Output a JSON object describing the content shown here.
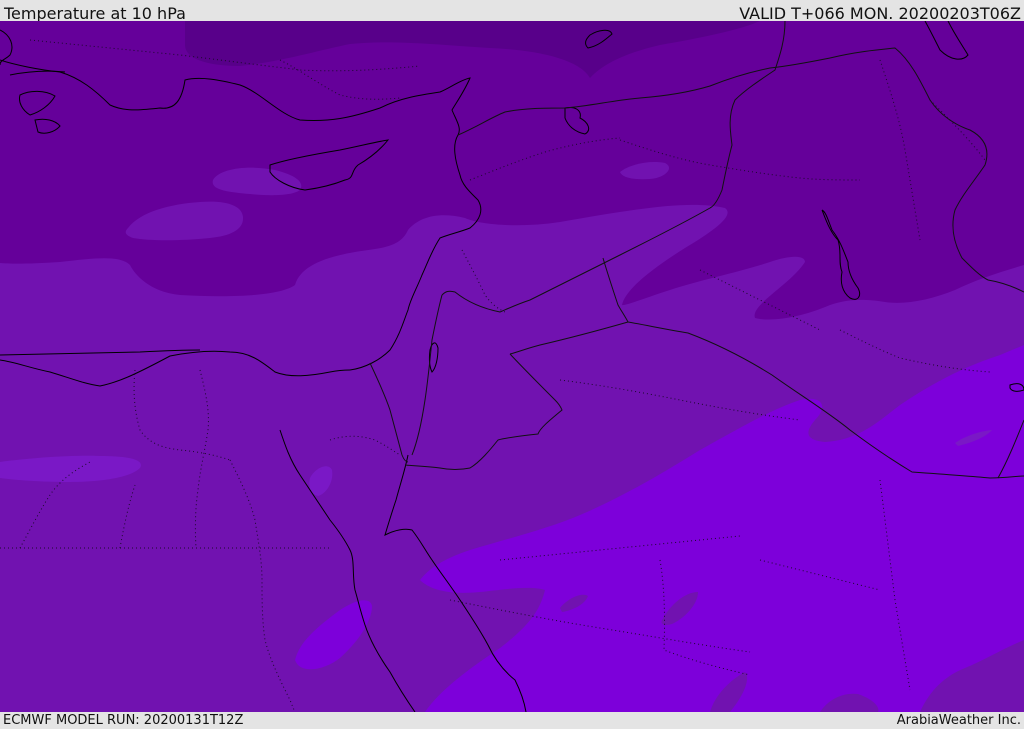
{
  "header": {
    "title": "Temperature at 10 hPa",
    "valid_time": "VALID T+066 MON. 20200203T06Z"
  },
  "footer": {
    "model_run": "ECMWF MODEL RUN: 20200131T12Z",
    "credit": "ArabiaWeather Inc."
  },
  "map": {
    "region": "Eastern Mediterranean / Middle East",
    "field": "temperature at 10 hPa (shaded bands, no colour scale shown)",
    "colors": {
      "band_darkest": "#58008a",
      "band_dark": "#65009a",
      "band_mid": "#7112b0",
      "band_light": "#7a18c6",
      "band_lightest": "#7d00da",
      "coastline": "#000000",
      "border": "#111111"
    }
  }
}
